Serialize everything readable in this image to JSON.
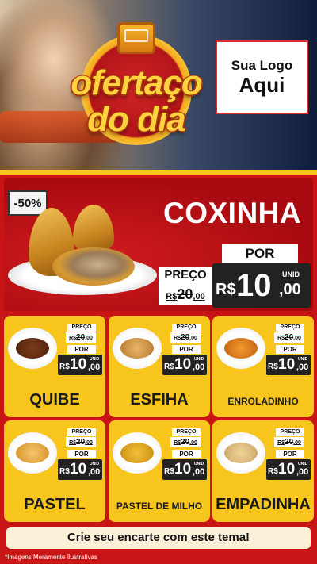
{
  "header": {
    "badge_line1": "ofertaço",
    "badge_line2": "do dia",
    "logo_line1": "Sua Logo",
    "logo_line2": "Aqui"
  },
  "hero": {
    "discount": "-50%",
    "product": "COXINHA",
    "preco_label": "PREÇO",
    "old_currency": "R$",
    "old_int": "20",
    "old_dec": ",00",
    "por_label": "POR",
    "currency": "R$",
    "price_int": "10",
    "price_dec": ",00",
    "unit": "UNID"
  },
  "products": [
    {
      "name": "QUIBE",
      "preco_label": "PREÇO",
      "old_currency": "R$",
      "old_int": "20",
      "old_dec": ",00",
      "por_label": "POR",
      "currency": "R$",
      "price_int": "10",
      "price_dec": ",00",
      "unit": "UNID"
    },
    {
      "name": "ESFIHA",
      "preco_label": "PREÇO",
      "old_currency": "R$",
      "old_int": "20",
      "old_dec": ",00",
      "por_label": "POR",
      "currency": "R$",
      "price_int": "10",
      "price_dec": ",00",
      "unit": "UNID"
    },
    {
      "name": "ENROLADINHO",
      "preco_label": "PREÇO",
      "old_currency": "R$",
      "old_int": "20",
      "old_dec": ",00",
      "por_label": "POR",
      "currency": "R$",
      "price_int": "10",
      "price_dec": ",00",
      "unit": "UNID"
    },
    {
      "name": "PASTEL",
      "preco_label": "PREÇO",
      "old_currency": "R$",
      "old_int": "20",
      "old_dec": ",00",
      "por_label": "POR",
      "currency": "R$",
      "price_int": "10",
      "price_dec": ",00",
      "unit": "UNID"
    },
    {
      "name": "PASTEL DE MILHO",
      "preco_label": "PREÇO",
      "old_currency": "R$",
      "old_int": "20",
      "old_dec": ",00",
      "por_label": "POR",
      "currency": "R$",
      "price_int": "10",
      "price_dec": ",00",
      "unit": "UNID"
    },
    {
      "name": "EMPADINHA",
      "preco_label": "PREÇO",
      "old_currency": "R$",
      "old_int": "20",
      "old_dec": ",00",
      "por_label": "POR",
      "currency": "R$",
      "price_int": "10",
      "price_dec": ",00",
      "unit": "UNID"
    }
  ],
  "footer": {
    "cta": "Crie seu encarte com este tema!",
    "disclaimer": "*Imagens Meramente Ilustrativas"
  },
  "colors": {
    "background_red": "#c91415",
    "card_yellow": "#f7c51c",
    "price_box": "#222222",
    "badge_gold": "#ffd23f"
  }
}
